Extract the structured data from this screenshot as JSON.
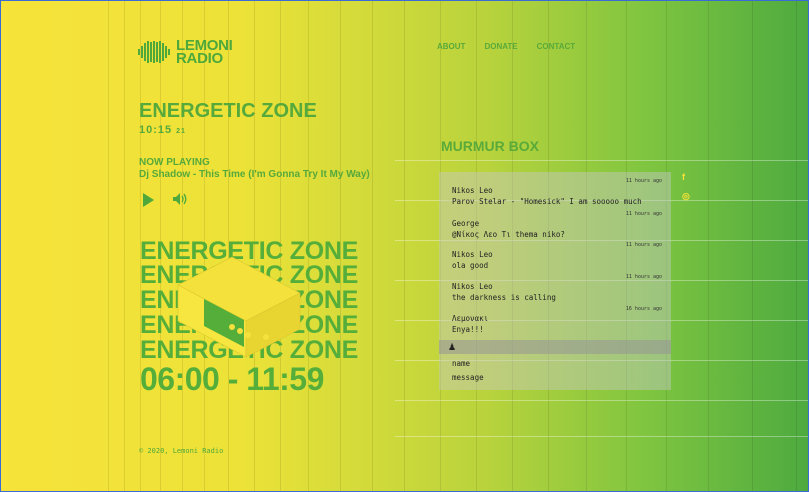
{
  "brand": {
    "name_line1": "LEMONI",
    "name_line2": "RADIO"
  },
  "nav": [
    {
      "label": "ABOUT"
    },
    {
      "label": "DONATE"
    },
    {
      "label": "CONTACT"
    }
  ],
  "show": {
    "title": "ENERGETIC ZONE",
    "clock": "10:15",
    "clock_suffix": "21",
    "now_playing_label": "NOW PLAYING",
    "track": "Dj Shadow - This Time (I'm Gonna Try It My Way)"
  },
  "poster": {
    "lines": [
      "ENERGETIC ZONE",
      "ENERGETIC ZONE",
      "ENERGETIC ZONE",
      "ENERGETIC ZONE",
      "ENERGETIC ZONE"
    ],
    "time_range": "06:00 - 11:59"
  },
  "murmur": {
    "title": "MURMUR BOX",
    "messages": [
      {
        "time": "11 hours ago",
        "user": "Nikos Leo",
        "text": "Parov Stelar - \"Homesick\" I am sooooo much"
      },
      {
        "time": "11 hours ago",
        "user": "George",
        "text": "@Νίκος Λεο Τι thema niko?"
      },
      {
        "time": "11 hours ago",
        "user": "Nikos Leo",
        "text": "ola good"
      },
      {
        "time": "11 hours ago",
        "user": "Nikos Leo",
        "text": "the darkness is calling"
      },
      {
        "time": "16 hours ago",
        "user": "Λεμονακι",
        "text": "Enya!!!"
      }
    ],
    "name_placeholder": "name",
    "message_placeholder": "message"
  },
  "social": {
    "facebook": "f",
    "instagram": "◎"
  },
  "footer": "© 2020, Lemoni Radio",
  "colors": {
    "accent": "#4ea83b",
    "bg_start": "#f7e33a",
    "bg_end": "#4daa3f"
  }
}
